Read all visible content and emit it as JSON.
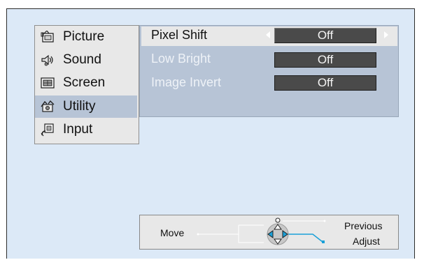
{
  "menu": {
    "items": [
      {
        "label": "Picture",
        "icon": "picture-icon",
        "active": false
      },
      {
        "label": "Sound",
        "icon": "sound-icon",
        "active": false
      },
      {
        "label": "Screen",
        "icon": "screen-icon",
        "active": false
      },
      {
        "label": "Utility",
        "icon": "utility-icon",
        "active": true
      },
      {
        "label": "Input",
        "icon": "input-icon",
        "active": false
      }
    ]
  },
  "options": [
    {
      "label": "Pixel Shift",
      "value": "Off",
      "selected": true
    },
    {
      "label": "Low Bright",
      "value": "Off",
      "selected": false
    },
    {
      "label": "Image Invert",
      "value": "Off",
      "selected": false
    }
  ],
  "help": {
    "move": "Move",
    "previous": "Previous",
    "adjust": "Adjust"
  },
  "colors": {
    "background": "#dce9f7",
    "panel": "#b7c4d6",
    "menu": "#e8e8e8",
    "value_box": "#4a4a4a",
    "connector": "#1aa0d8"
  }
}
